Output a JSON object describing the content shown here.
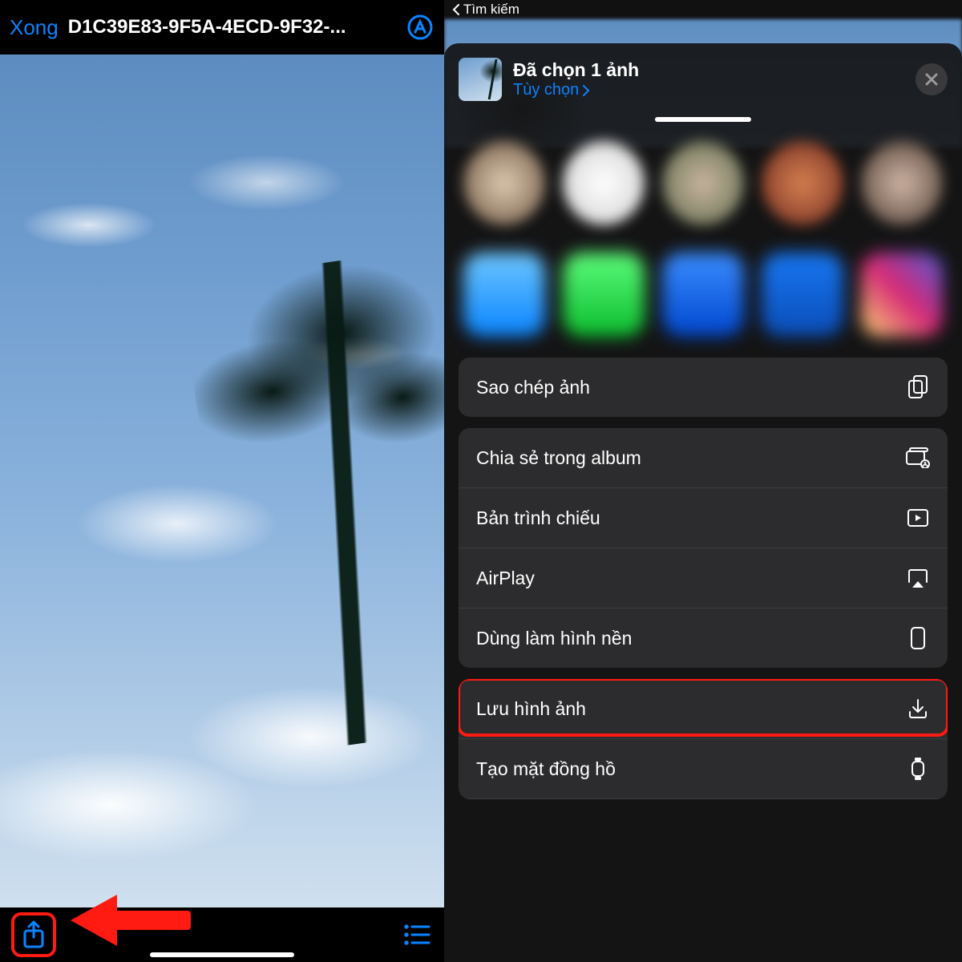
{
  "left": {
    "done_label": "Xong",
    "file_title": "D1C39E83-9F5A-4ECD-9F32-...",
    "icons": {
      "markup": "markup-icon",
      "share": "share-icon",
      "list": "list-icon"
    }
  },
  "right": {
    "back_label": "Tìm kiếm",
    "sheet_title": "Đã chọn 1 ảnh",
    "options_label": "Tùy chọn",
    "actions_group1": [
      {
        "label": "Sao chép ảnh",
        "icon": "copy-icon"
      }
    ],
    "actions_group2": [
      {
        "label": "Chia sẻ trong album",
        "icon": "shared-album-icon"
      },
      {
        "label": "Bản trình chiếu",
        "icon": "slideshow-icon"
      },
      {
        "label": "AirPlay",
        "icon": "airplay-icon"
      },
      {
        "label": "Dùng làm hình nền",
        "icon": "wallpaper-icon"
      }
    ],
    "actions_group3": [
      {
        "label": "Lưu hình ảnh",
        "icon": "download-icon",
        "highlighted": true
      },
      {
        "label": "Tạo mặt đồng hồ",
        "icon": "watch-icon"
      }
    ]
  },
  "colors": {
    "accent": "#0a84ff",
    "highlight": "#ff1a12"
  }
}
